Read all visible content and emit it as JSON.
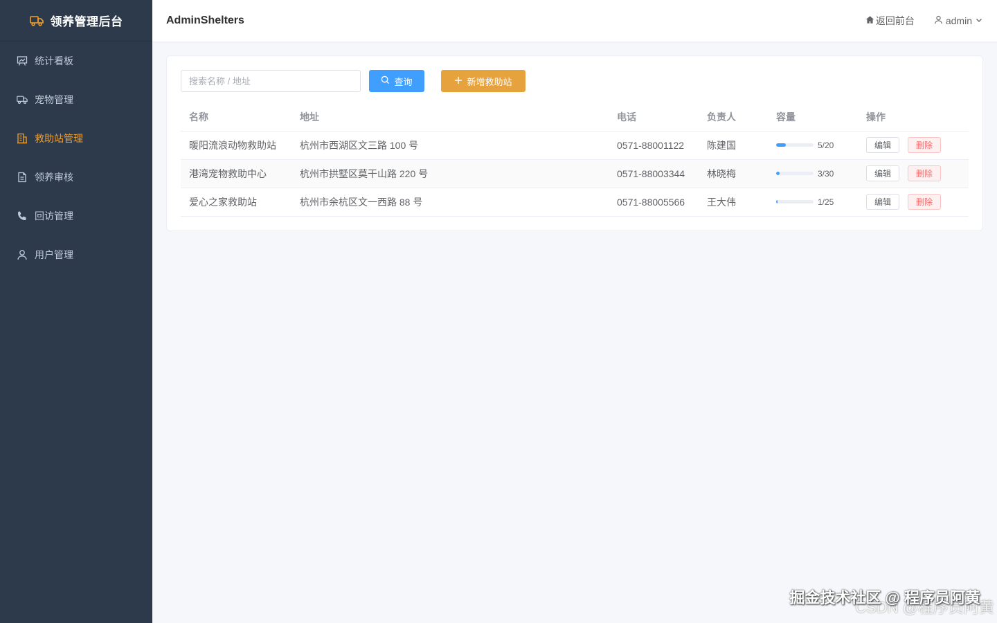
{
  "sidebar": {
    "brand_icon": "truck-icon",
    "brand_title": "领养管理后台",
    "accent_color": "#f0a030",
    "items": [
      {
        "label": "统计看板",
        "icon": "presentation-chart-icon",
        "active": false
      },
      {
        "label": "宠物管理",
        "icon": "truck-icon",
        "active": false
      },
      {
        "label": "救助站管理",
        "icon": "building-icon",
        "active": true
      },
      {
        "label": "领养审核",
        "icon": "document-icon",
        "active": false
      },
      {
        "label": "回访管理",
        "icon": "phone-icon",
        "active": false
      },
      {
        "label": "用户管理",
        "icon": "user-icon",
        "active": false
      }
    ]
  },
  "header": {
    "title": "AdminShelters",
    "back_link": "返回前台",
    "username": "admin"
  },
  "toolbar": {
    "search_placeholder": "搜索名称 / 地址",
    "query_label": "查询",
    "add_label": "新增救助站"
  },
  "table": {
    "columns": [
      "名称",
      "地址",
      "电话",
      "负责人",
      "容量",
      "操作"
    ],
    "rows": [
      {
        "name": "暖阳流浪动物救助站",
        "address": "杭州市西湖区文三路 100 号",
        "phone": "0571-88001122",
        "manager": "陈建国",
        "capacity": "5/20",
        "capacity_fraction": 0.25
      },
      {
        "name": "港湾宠物救助中心",
        "address": "杭州市拱墅区莫干山路 220 号",
        "phone": "0571-88003344",
        "manager": "林晓梅",
        "capacity": "3/30",
        "capacity_fraction": 0.1
      },
      {
        "name": "爱心之家救助站",
        "address": "杭州市余杭区文一西路 88 号",
        "phone": "0571-88005566",
        "manager": "王大伟",
        "capacity": "1/25",
        "capacity_fraction": 0.04
      }
    ],
    "edit_label": "编辑",
    "delete_label": "删除"
  },
  "watermark": {
    "primary": "掘金技术社区 @ 程序员阿黄",
    "secondary": "CSDN @程序员阿黄"
  }
}
